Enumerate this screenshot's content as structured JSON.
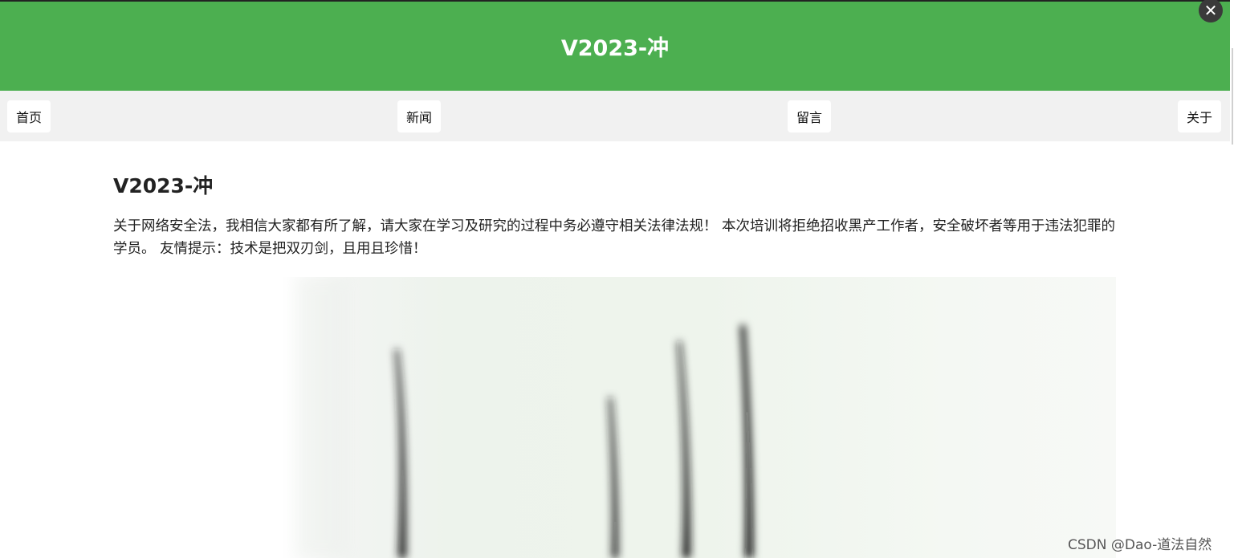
{
  "header": {
    "title": "V2023-冲",
    "close_symbol": "✕"
  },
  "nav": {
    "items": [
      {
        "label": "首页"
      },
      {
        "label": "新闻"
      },
      {
        "label": "留言"
      },
      {
        "label": "关于"
      }
    ]
  },
  "main": {
    "title": "V2023-冲",
    "paragraph": "关于网络安全法，我相信大家都有所了解，请大家在学习及研究的过程中务必遵守相关法律法规！ 本次培训将拒绝招收黑产工作者，安全破坏者等用于违法犯罪的学员。 友情提示：技术是把双刃剑，且用且珍惜！"
  },
  "watermark": "CSDN @Dao-道法自然",
  "colors": {
    "header_bg": "#4caf50",
    "nav_bg": "#f1f1f1",
    "image_tint": "#eef4ec"
  }
}
